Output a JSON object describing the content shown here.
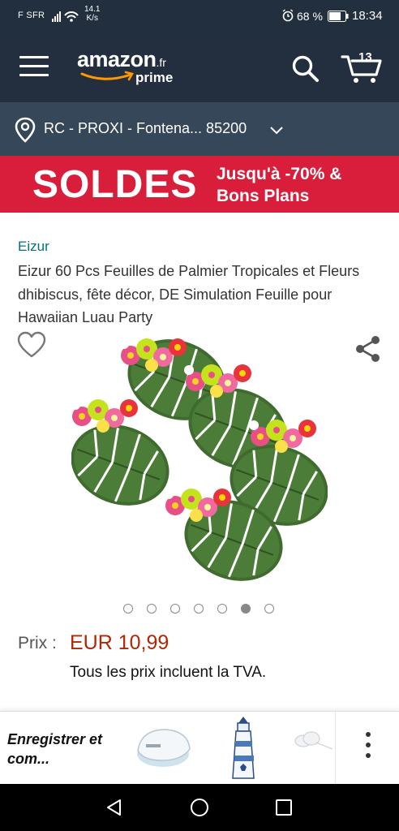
{
  "status_bar": {
    "carrier": "F SFR",
    "speed_value": "14.1",
    "speed_unit": "K/s",
    "battery": "68 %",
    "time": "18:34"
  },
  "header": {
    "logo_word": "amazon",
    "logo_tld": ".fr",
    "logo_prime": "prime",
    "cart_count": "13"
  },
  "location": {
    "text": "RC - PROXI - Fontena... 85200"
  },
  "banner": {
    "headline": "SOLDES",
    "line1": "Jusqu'à -70% &",
    "line2": "Bons Plans",
    "color": "#d81e3a"
  },
  "product": {
    "brand": "Eizur",
    "title": "Eizur 60 Pcs Feuilles de Palmier Tropicales et Fleurs dhibiscus, fête décor, DE Simulation Feuille pour Hawaiian Luau Party",
    "image_count": 7,
    "active_image": 6,
    "price_label": "Prix :",
    "price_value": "EUR 10,99",
    "vat_note": "Tous les prix incluent la TVA."
  },
  "recommendations": {
    "label": "Enregistrer et com...",
    "items": [
      "printer-thumbnail",
      "lighthouse-thumbnail",
      "clouds-thumbnail"
    ]
  },
  "colors": {
    "header": "#232f3e",
    "location_bar": "#37475a",
    "price": "#b12704",
    "link": "#007185"
  },
  "icons": [
    "menu-icon",
    "search-icon",
    "cart-icon",
    "location-pin-icon",
    "chevron-down-icon",
    "heart-icon",
    "share-icon",
    "more-vertical-icon",
    "back-icon",
    "home-icon",
    "recents-icon"
  ]
}
